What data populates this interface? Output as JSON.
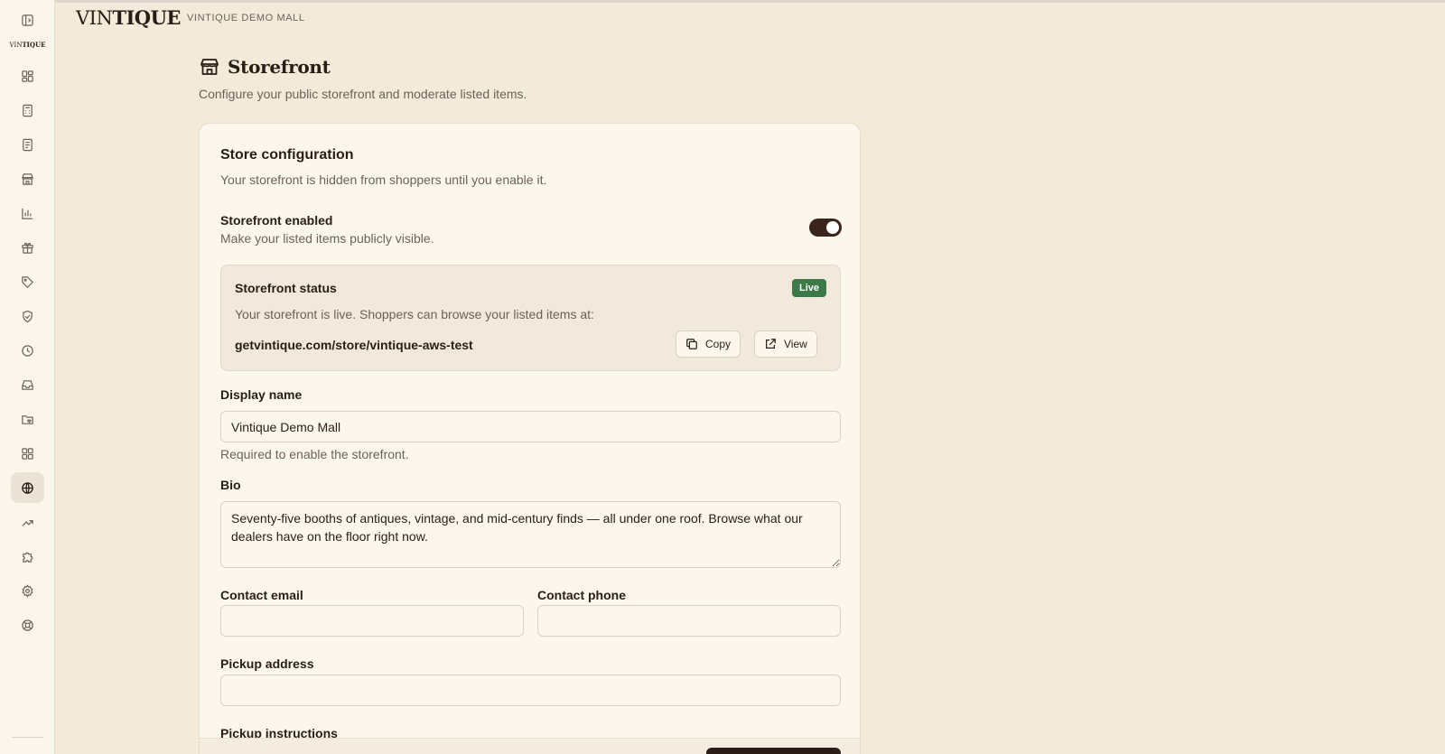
{
  "brand": {
    "name_light": "VIN",
    "name_bold": "TIQUE",
    "mall": "VINTIQUE DEMO MALL"
  },
  "sidebar": {
    "logo_light": "VIN",
    "logo_bold": "TIQUE",
    "items": [
      {
        "icon": "sidebar-toggle-icon"
      },
      {
        "icon": "dashboard-icon"
      },
      {
        "icon": "calculator-icon"
      },
      {
        "icon": "document-icon"
      },
      {
        "icon": "storefront-icon"
      },
      {
        "icon": "bar-chart-icon"
      },
      {
        "icon": "gift-icon"
      },
      {
        "icon": "tag-icon"
      },
      {
        "icon": "shield-check-icon"
      },
      {
        "icon": "clock-icon"
      },
      {
        "icon": "inbox-icon"
      },
      {
        "icon": "folder-heart-icon"
      },
      {
        "icon": "apps-grid-icon"
      },
      {
        "icon": "globe-icon",
        "active": true
      },
      {
        "icon": "trending-up-icon"
      },
      {
        "icon": "puzzle-icon"
      },
      {
        "icon": "gear-icon"
      },
      {
        "icon": "lifebuoy-icon"
      }
    ]
  },
  "page": {
    "title": "Storefront",
    "subtitle": "Configure your public storefront and moderate listed items."
  },
  "config": {
    "title": "Store configuration",
    "subtitle": "Your storefront is hidden from shoppers until you enable it.",
    "enabled_label": "Storefront enabled",
    "enabled_help": "Make your listed items publicly visible.",
    "enabled": true,
    "status": {
      "title": "Storefront status",
      "badge": "Live",
      "badge_color": "#3d7a4a",
      "text": "Your storefront is live. Shoppers can browse your listed items at:",
      "url": "getvintique.com/store/vintique-aws-test",
      "copy_label": "Copy",
      "view_label": "View"
    },
    "display_name": {
      "label": "Display name",
      "value": "Vintique Demo Mall",
      "help": "Required to enable the storefront."
    },
    "bio": {
      "label": "Bio",
      "value": "Seventy-five booths of antiques, vintage, and mid-century finds — all under one roof. Browse what our dealers have on the floor right now."
    },
    "contact_email": {
      "label": "Contact email",
      "value": ""
    },
    "contact_phone": {
      "label": "Contact phone",
      "value": ""
    },
    "pickup_address": {
      "label": "Pickup address",
      "value": ""
    },
    "pickup_instructions": {
      "label": "Pickup instructions"
    }
  },
  "colors": {
    "background": "#f3ead9",
    "card": "#fcf7ec",
    "accent": "#2a1d17",
    "live": "#3d7a4a"
  }
}
